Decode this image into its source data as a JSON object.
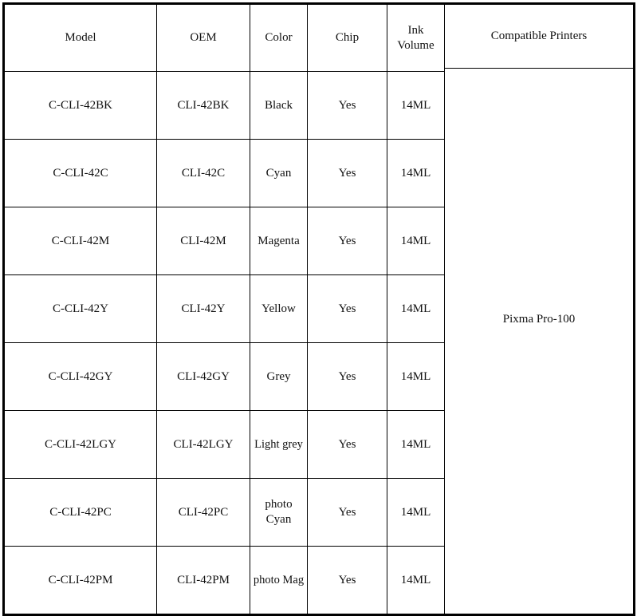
{
  "table": {
    "headers": [
      {
        "id": "model",
        "label": "Model"
      },
      {
        "id": "oem",
        "label": "OEM"
      },
      {
        "id": "color",
        "label": "Color"
      },
      {
        "id": "chip",
        "label": "Chip"
      },
      {
        "id": "ink_volume",
        "label": "Ink\nVolume",
        "line1": "Ink",
        "line2": "Volume"
      },
      {
        "id": "compatible_printers",
        "label": "Compatible Printers"
      }
    ],
    "rows": [
      {
        "model": "C-CLI-42BK",
        "oem": "CLI-42BK",
        "color": "Black",
        "chip": "Yes",
        "ink_volume": "14ML"
      },
      {
        "model": "C-CLI-42C",
        "oem": "CLI-42C",
        "color": "Cyan",
        "chip": "Yes",
        "ink_volume": "14ML"
      },
      {
        "model": "C-CLI-42M",
        "oem": "CLI-42M",
        "color": "Magenta",
        "chip": "Yes",
        "ink_volume": "14ML"
      },
      {
        "model": "C-CLI-42Y",
        "oem": "CLI-42Y",
        "color": "Yellow",
        "chip": "Yes",
        "ink_volume": "14ML"
      },
      {
        "model": "C-CLI-42GY",
        "oem": "CLI-42GY",
        "color": "Grey",
        "chip": "Yes",
        "ink_volume": "14ML"
      },
      {
        "model": "C-CLI-42LGY",
        "oem": "CLI-42LGY",
        "color": "Light grey",
        "chip": "Yes",
        "ink_volume": "14ML"
      },
      {
        "model": "C-CLI-42PC",
        "oem": "CLI-42PC",
        "color": "photo Cyan",
        "color_line1": "photo",
        "color_line2": "Cyan",
        "chip": "Yes",
        "ink_volume": "14ML"
      },
      {
        "model": "C-CLI-42PM",
        "oem": "CLI-42PM",
        "color": "photo Mag",
        "chip": "Yes",
        "ink_volume": "14ML"
      }
    ],
    "compatible_printers_value": "Pixma Pro-100",
    "colors": {
      "border": "#000000",
      "text": "#111111",
      "background": "#ffffff"
    }
  }
}
